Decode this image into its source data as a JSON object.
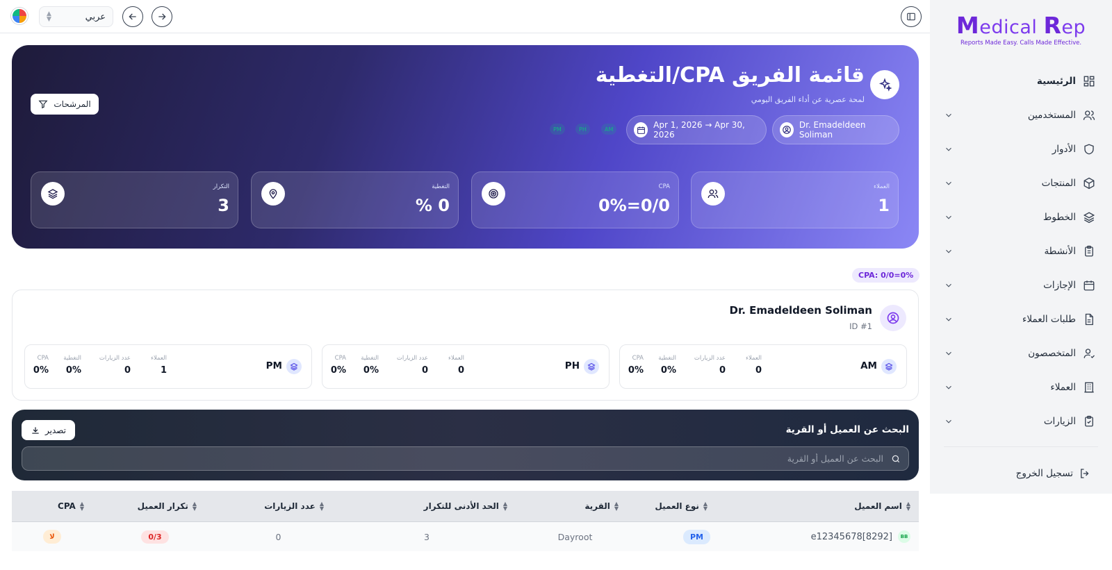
{
  "brand": {
    "name_part1": "M",
    "name_part2": "edical ",
    "name_part3": "R",
    "name_part4": "ep",
    "tagline": "Reports Made Easy. Calls Made Effective."
  },
  "sidebar": {
    "items": [
      {
        "label": "الرئيسية",
        "icon": "grid-icon",
        "active": true
      },
      {
        "label": "المستخدمين",
        "icon": "users-icon"
      },
      {
        "label": "الأدوار",
        "icon": "shield-icon"
      },
      {
        "label": "المنتجات",
        "icon": "box-icon"
      },
      {
        "label": "الخطوط",
        "icon": "layers-icon"
      },
      {
        "label": "الأنشطة",
        "icon": "clipboard-icon"
      },
      {
        "label": "الإجازات",
        "icon": "calendar-icon"
      },
      {
        "label": "طلبات العملاء",
        "icon": "file-icon"
      },
      {
        "label": "المتخصصون",
        "icon": "user-check-icon"
      },
      {
        "label": "العملاء",
        "icon": "building-icon"
      },
      {
        "label": "الزيارات",
        "icon": "clipboard-check-icon"
      }
    ],
    "logout_label": "تسجيل الخروج"
  },
  "topbar": {
    "language": "عربي"
  },
  "hero": {
    "title": "قائمة الفريق CPA/التغطية",
    "subtitle": "لمحة عصرية عن أداء الفريق اليومي",
    "filters_label": "المرشحات",
    "rep_pill": "Dr. Emadeldeen Soliman",
    "date_pill": "Apr 1, 2026 → Apr 30, 2026",
    "chips": [
      "AM",
      "PH",
      "PM"
    ],
    "stats": [
      {
        "label": "العملاء",
        "value": "1",
        "icon": "users-icon"
      },
      {
        "label": "CPA",
        "value": "0%=0/0",
        "icon": "target-icon"
      },
      {
        "label": "التغطية",
        "value": "% 0",
        "icon": "map-pin-icon"
      },
      {
        "label": "التكرار",
        "value": "3",
        "icon": "layers-icon"
      }
    ]
  },
  "cpa_chip": "CPA: 0/0=0%",
  "rep": {
    "name": "Dr. Emadeldeen Soliman",
    "id": "ID #1",
    "segments": [
      {
        "name": "AM",
        "clients_label": "العملاء",
        "clients": "0",
        "visits_label": "عدد الزيارات",
        "visits": "0",
        "coverage_label": "التغطية",
        "coverage": "0%",
        "cpa_label": "CPA",
        "cpa": "0%"
      },
      {
        "name": "PH",
        "clients_label": "العملاء",
        "clients": "0",
        "visits_label": "عدد الزيارات",
        "visits": "0",
        "coverage_label": "التغطية",
        "coverage": "0%",
        "cpa_label": "CPA",
        "cpa": "0%"
      },
      {
        "name": "PM",
        "clients_label": "العملاء",
        "clients": "1",
        "visits_label": "عدد الزيارات",
        "visits": "0",
        "coverage_label": "التغطية",
        "coverage": "0%",
        "cpa_label": "CPA",
        "cpa": "0%"
      }
    ]
  },
  "search": {
    "title": "البحث عن العميل أو القرية",
    "placeholder": "البحث عن العميل أو القرية",
    "export_label": "تصدير"
  },
  "table": {
    "headers": [
      "اسم العميل",
      "نوع العميل",
      "القرية",
      "الحد الأدنى للتكرار",
      "عدد الزيارات",
      "تكرار العميل",
      "CPA"
    ],
    "rows": [
      {
        "badge": "BB",
        "name": "e12345678[8292]",
        "type": "PM",
        "village": "Dayroot",
        "min_freq": "3",
        "visits": "0",
        "client_freq": "0/3",
        "cpa": "لا"
      }
    ]
  }
}
